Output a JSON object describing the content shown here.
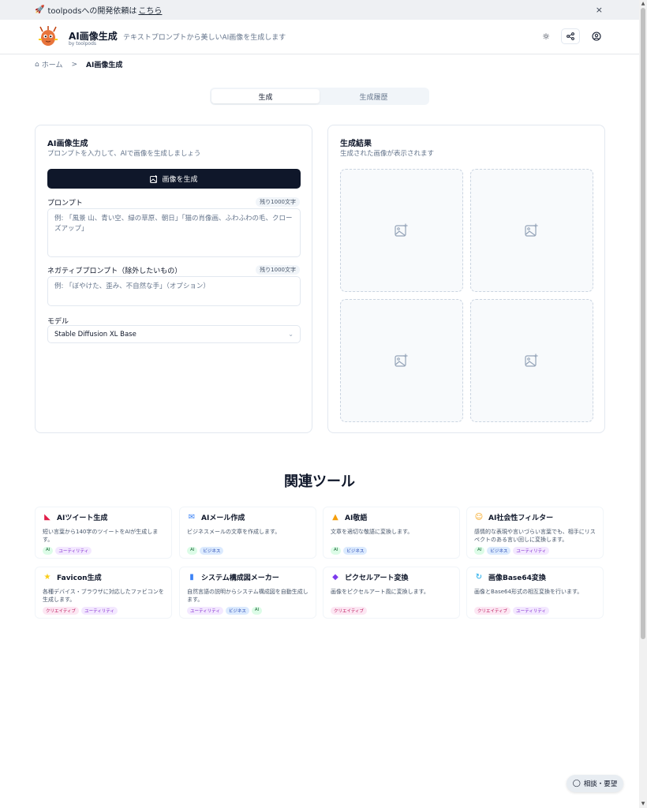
{
  "banner": {
    "text": "toolpodsへの開発依頼は",
    "link": "こちら",
    "close": "×"
  },
  "header": {
    "title": "AI画像生成",
    "by": "by toolpods",
    "description": "テキストプロンプトから美しいAI画像を生成します"
  },
  "breadcrumb": {
    "home": "ホーム",
    "sep": ">",
    "current": "AI画像生成"
  },
  "tabs": [
    {
      "label": "生成"
    },
    {
      "label": "生成履歴"
    }
  ],
  "form": {
    "title": "AI画像生成",
    "subtitle": "プロンプトを入力して、AIで画像を生成しましょう",
    "generate_label": "画像を生成",
    "prompt_label": "プロンプト",
    "prompt_counter": "残り1000文字",
    "prompt_placeholder": "例: 「風景 山、青い空、緑の草原、朝日」「猫の肖像画、ふわふわの毛、クローズアップ」",
    "negative_label": "ネガティブプロンプト（除外したいもの）",
    "negative_counter": "残り1000文字",
    "negative_placeholder": "例: 「ぼやけた、歪み、不自然な手」（オプション）",
    "model_label": "モデル",
    "model_value": "Stable Diffusion XL Base"
  },
  "result": {
    "title": "生成結果",
    "subtitle": "生成された画像が表示されます"
  },
  "related": {
    "title": "関連ツール",
    "tools": [
      {
        "name": "AIツイート生成",
        "icon": "tweet-icon",
        "color": "#e11d48",
        "desc": "短い言葉から140字のツイートをAIが生成します。",
        "tags": [
          {
            "label": "AI",
            "type": "ai"
          },
          {
            "label": "ユーティリティ",
            "type": "util"
          }
        ]
      },
      {
        "name": "AIメール作成",
        "icon": "mail-icon",
        "color": "#3b82f6",
        "desc": "ビジネスメールの文章を作成します。",
        "tags": [
          {
            "label": "AI",
            "type": "ai"
          },
          {
            "label": "ビジネス",
            "type": "biz"
          }
        ]
      },
      {
        "name": "AI敬語",
        "icon": "bow-icon",
        "color": "#f59e0b",
        "desc": "文章を適切な敬語に変換します。",
        "tags": [
          {
            "label": "AI",
            "type": "ai"
          },
          {
            "label": "ビジネス",
            "type": "biz"
          }
        ]
      },
      {
        "name": "AI社会性フィルター",
        "icon": "smile-icon",
        "color": "#f59e0b",
        "desc": "感情的な表現や言いづらい言葉でも、相手にリスペクトのある言い回しに変換します。",
        "tags": [
          {
            "label": "AI",
            "type": "ai"
          },
          {
            "label": "ビジネス",
            "type": "biz"
          },
          {
            "label": "ユーティリティ",
            "type": "util"
          }
        ]
      },
      {
        "name": "Favicon生成",
        "icon": "star-icon",
        "color": "#facc15",
        "desc": "各種デバイス・ブラウザに対応したファビコンを生成します。",
        "tags": [
          {
            "label": "クリエイティブ",
            "type": "creative"
          },
          {
            "label": "ユーティリティ",
            "type": "util"
          }
        ]
      },
      {
        "name": "システム構成図メーカー",
        "icon": "bar-chart-icon",
        "color": "#3b82f6",
        "desc": "自然言語の説明からシステム構成図を自動生成します。",
        "tags": [
          {
            "label": "ユーティリティ",
            "type": "util"
          },
          {
            "label": "ビジネス",
            "type": "biz"
          },
          {
            "label": "AI",
            "type": "ai"
          }
        ]
      },
      {
        "name": "ピクセルアート変換",
        "icon": "gamepad-icon",
        "color": "#7c3aed",
        "desc": "画像をピクセルアート風に変換します。",
        "tags": [
          {
            "label": "クリエイティブ",
            "type": "creative"
          }
        ]
      },
      {
        "name": "画像Base64変換",
        "icon": "refresh-icon",
        "color": "#0ea5e9",
        "desc": "画像とBase64形式の相互変換を行います。",
        "tags": [
          {
            "label": "クリエイティブ",
            "type": "creative"
          },
          {
            "label": "ユーティリティ",
            "type": "util"
          }
        ]
      }
    ]
  },
  "chat": {
    "label": "相談・要望"
  }
}
